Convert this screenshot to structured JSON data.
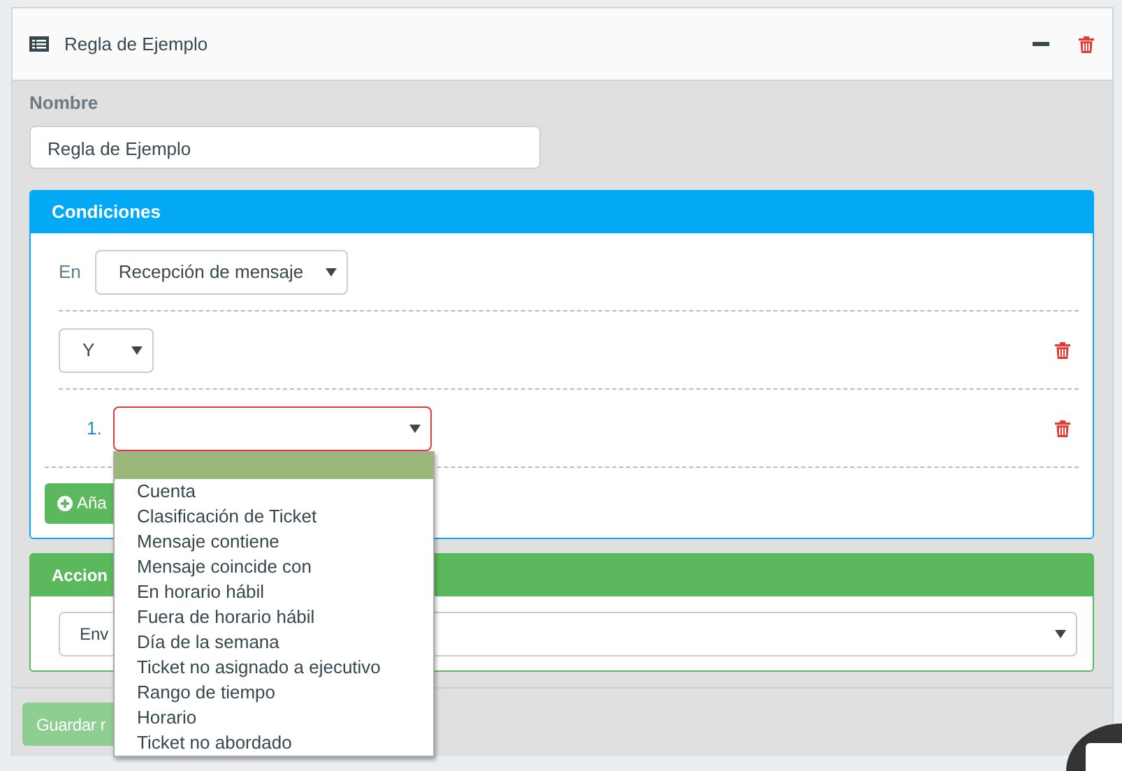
{
  "rule_card": {
    "title": "Regla de Ejemplo"
  },
  "name_field": {
    "label": "Nombre",
    "value": "Regla de Ejemplo"
  },
  "conditions": {
    "title": "Condiciones",
    "trigger_label": "En",
    "trigger": "Recepción de mensaje",
    "operator": "Y",
    "rows": [
      {
        "number": "1.",
        "invalid": true,
        "dropdown_open": true,
        "options": [
          {
            "selected": true
          },
          {
            "label": "Cuenta",
            "selected": false
          },
          {
            "label": "Clasificación de Ticket",
            "selected": false
          },
          {
            "label": "Mensaje contiene",
            "selected": false
          },
          {
            "label": "Mensaje coincide con",
            "selected": false
          },
          {
            "label": "En horario hábil",
            "selected": false
          },
          {
            "label": "Fuera de horario hábil",
            "selected": false
          },
          {
            "label": "Día de la semana",
            "selected": false
          },
          {
            "label": "Ticket no asignado a ejecutivo",
            "selected": false
          },
          {
            "label": "Rango de tiempo",
            "selected": false
          },
          {
            "label": "Horario",
            "selected": false
          },
          {
            "label": "Ticket no abordado",
            "selected": false
          }
        ]
      }
    ],
    "add_button": "Aña"
  },
  "actions": {
    "title": "Accion",
    "action": "Env"
  },
  "save_button": {
    "label": "Guardar r",
    "disabled": true
  }
}
